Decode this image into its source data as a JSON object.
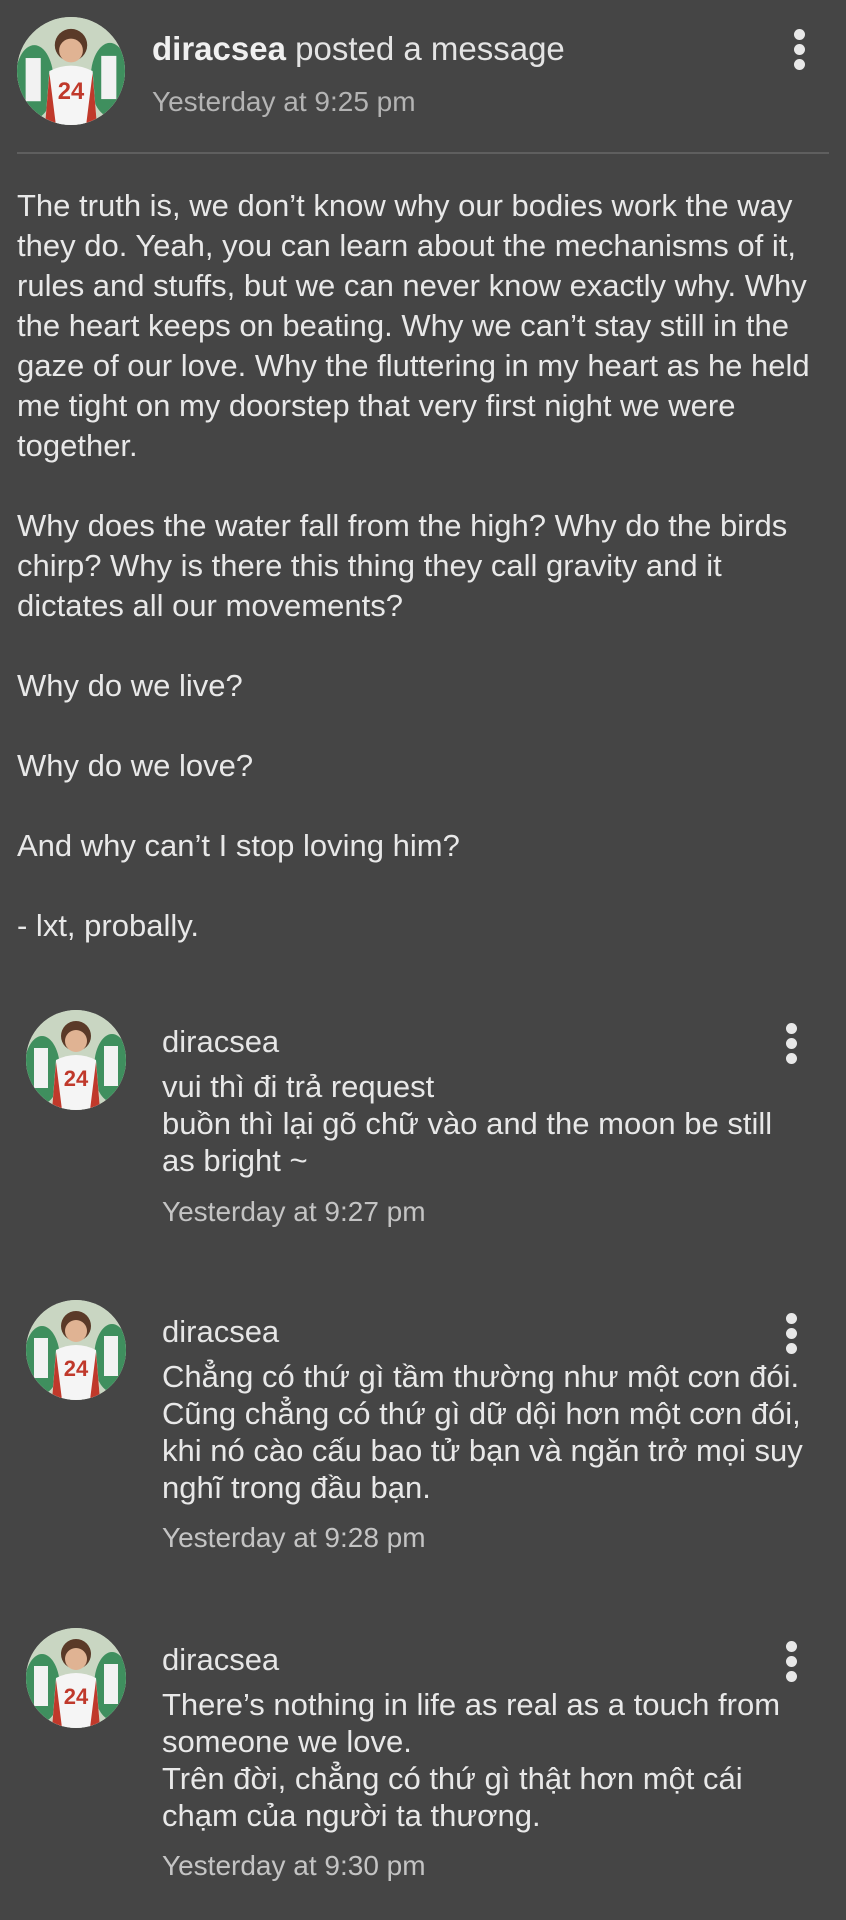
{
  "post": {
    "author": "diracsea",
    "action": "posted a message",
    "timestamp": "Yesterday at 9:25 pm",
    "paragraphs": [
      "The truth is, we don’t know why our bodies work the way they do. Yeah, you can learn about the mechanisms of it, rules and stuffs, but we can never know exactly why. Why the heart keeps on beating. Why we can’t stay still in the gaze of our love. Why the fluttering in my heart as he held me tight on my doorstep that very first night we were together.",
      "Why does the water fall from the high? Why do the birds chirp? Why is there this thing they call gravity and it dictates all our movements?",
      "Why do we live?",
      "Why do we love?",
      "And why can’t I stop loving him?",
      "- lxt, probally."
    ]
  },
  "comments": [
    {
      "author": "diracsea",
      "text": "vui thì đi trả request\nbuồn thì lại gõ chữ vào and the moon be still as bright ~",
      "timestamp": "Yesterday at 9:27 pm"
    },
    {
      "author": "diracsea",
      "text": "Chẳng có thứ gì tầm thường như một cơn đói. Cũng chẳng có thứ gì dữ dội hơn một cơn đói, khi nó cào cấu bao tử bạn và ngăn trở mọi suy nghĩ trong đầu bạn.",
      "timestamp": "Yesterday at 9:28 pm"
    },
    {
      "author": "diracsea",
      "text": "There’s nothing in life as real as a touch from someone we love.\nTrên đời, chẳng có thứ gì thật hơn một cái chạm của người ta thương.",
      "timestamp": "Yesterday at 9:30 pm"
    }
  ],
  "avatar_jersey_number": "24",
  "icons": {
    "more": "more-vertical-icon"
  },
  "colors": {
    "background": "#454545",
    "text": "#e8e8e8",
    "muted_text": "#b4b4b4",
    "divider": "#5f5f5f"
  }
}
